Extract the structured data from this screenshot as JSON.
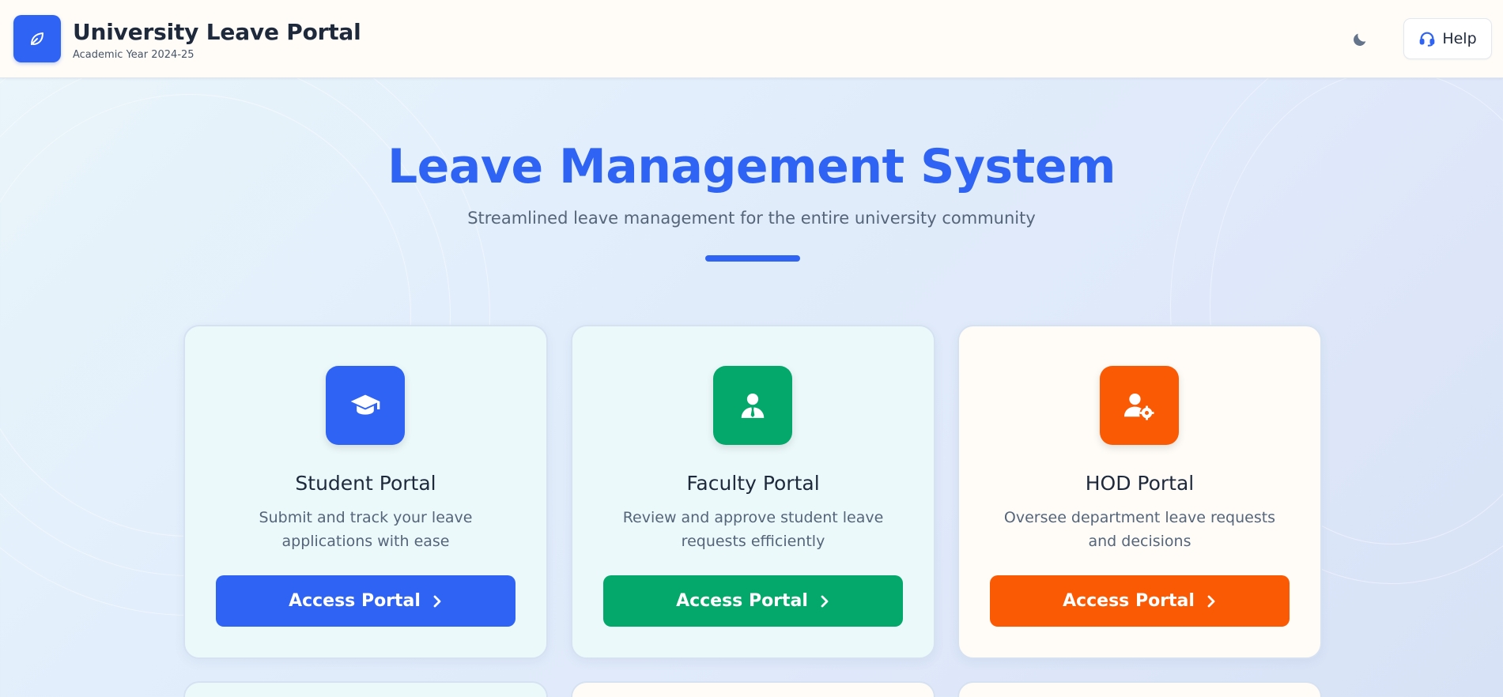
{
  "header": {
    "title": "University Leave Portal",
    "subtitle": "Academic Year 2024-25",
    "logo_icon": "leaf-icon",
    "theme_toggle_icon": "moon-icon",
    "help_label": "Help",
    "help_icon": "headset-icon"
  },
  "hero": {
    "title": "Leave Management System",
    "subtitle": "Streamlined leave management for the entire university community"
  },
  "portals": [
    {
      "title": "Student Portal",
      "description": "Submit and track your leave applications with ease",
      "button_label": "Access Portal",
      "icon": "graduation-cap-icon",
      "accent": "#2f63f3"
    },
    {
      "title": "Faculty Portal",
      "description": "Review and approve student leave requests efficiently",
      "button_label": "Access Portal",
      "icon": "user-tie-icon",
      "accent": "#05a86b"
    },
    {
      "title": "HOD Portal",
      "description": "Oversee department leave requests and decisions",
      "button_label": "Access Portal",
      "icon": "user-gear-icon",
      "accent": "#fb5a05"
    }
  ],
  "colors": {
    "primary": "#2f63f3",
    "success": "#05a86b",
    "orange": "#fb5a05"
  }
}
